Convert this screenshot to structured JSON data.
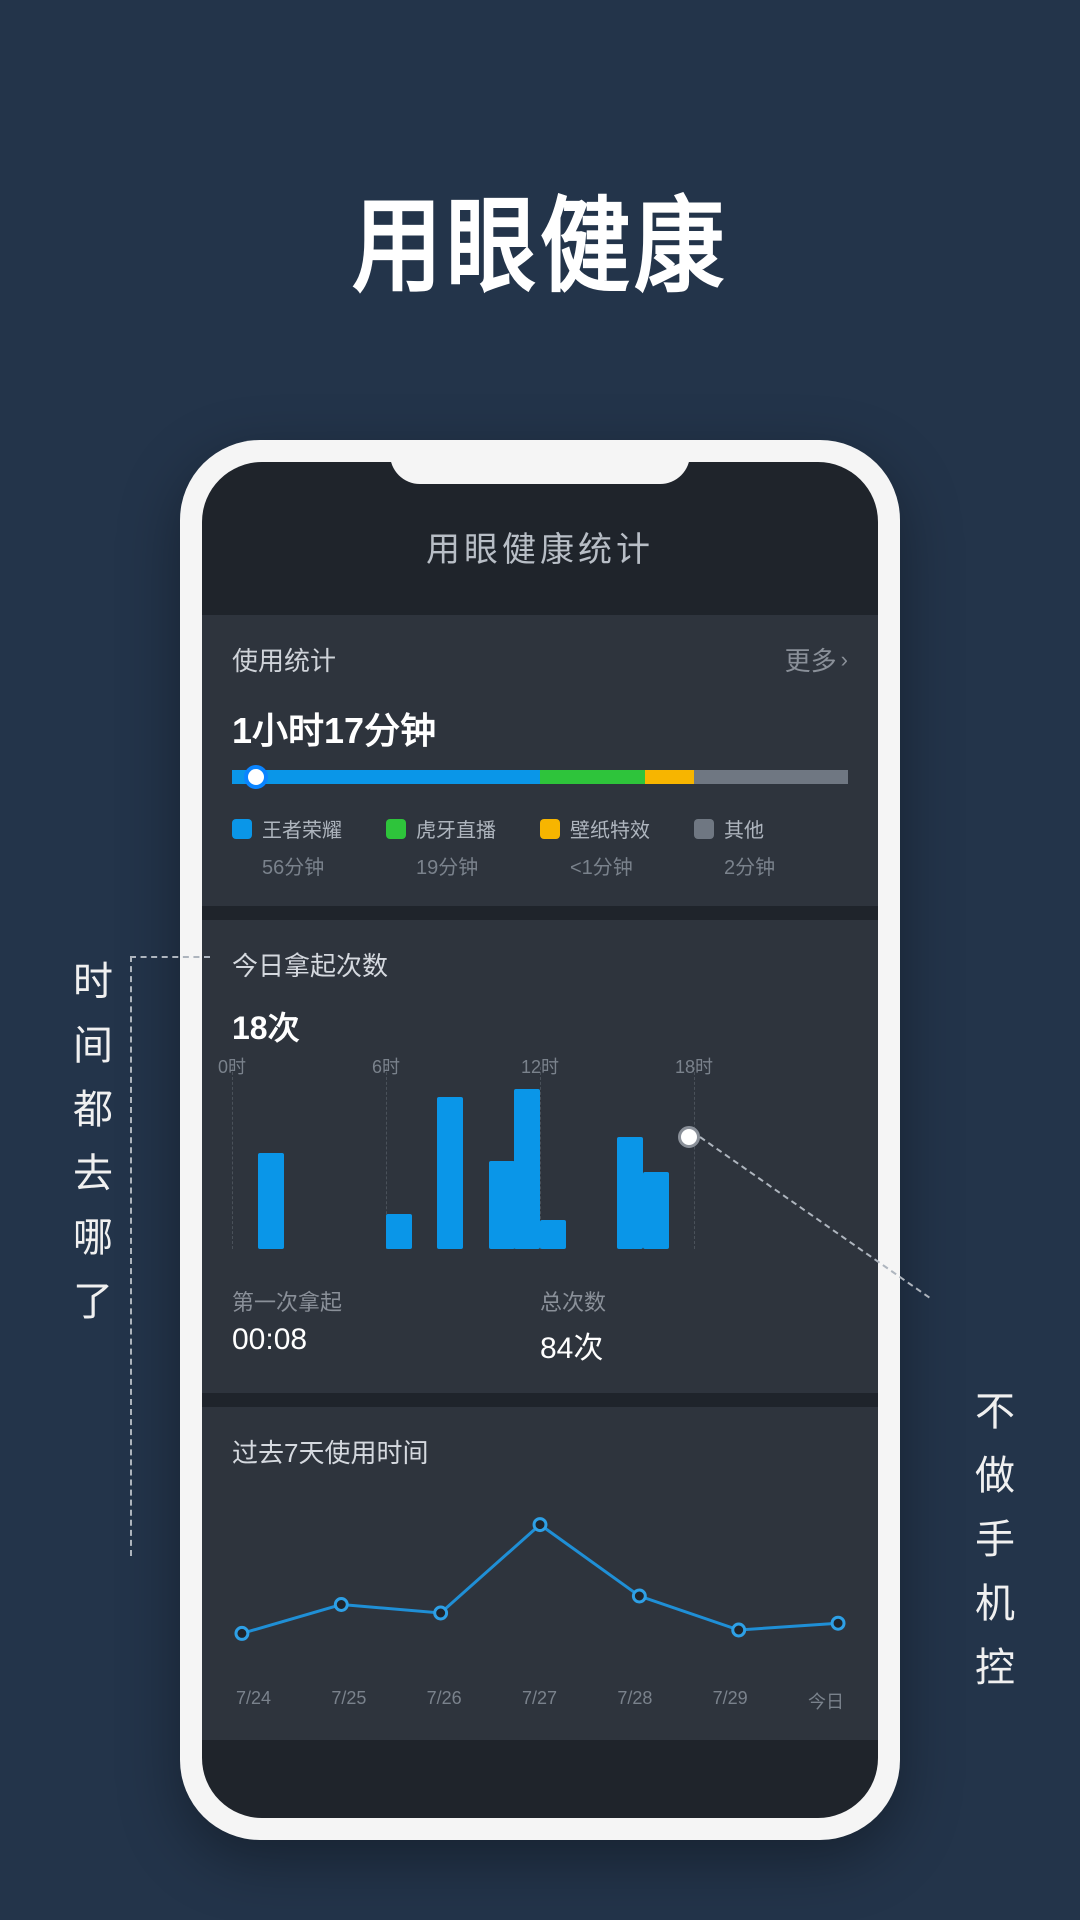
{
  "page_title": "用眼健康",
  "side_left": "时间都去哪了",
  "side_right": "不做手机控",
  "screen_title": "用眼健康统计",
  "usage": {
    "header": "使用统计",
    "more": "更多",
    "total": "1小时17分钟",
    "segments": [
      {
        "name": "王者荣耀",
        "time": "56分钟",
        "color": "#0a96e8",
        "pct": 50
      },
      {
        "name": "虎牙直播",
        "time": "19分钟",
        "color": "#2ec43b",
        "pct": 17
      },
      {
        "name": "壁纸特效",
        "time": "<1分钟",
        "color": "#f7b500",
        "pct": 8
      },
      {
        "name": "其他",
        "time": "2分钟",
        "color": "#6f7782",
        "pct": 25
      }
    ]
  },
  "pickups": {
    "title": "今日拿起次数",
    "count": "18次",
    "first_label": "第一次拿起",
    "first_value": "00:08",
    "total_label": "总次数",
    "total_value": "84次",
    "axis": [
      "0时",
      "6时",
      "12时",
      "18时"
    ]
  },
  "week": {
    "title": "过去7天使用时间",
    "labels": [
      "7/24",
      "7/25",
      "7/26",
      "7/27",
      "7/28",
      "7/29",
      "今日"
    ]
  },
  "chart_data": [
    {
      "type": "bar",
      "title": "今日拿起次数",
      "x_marks": [
        0,
        6,
        12,
        18
      ],
      "bars": [
        {
          "hour": 1,
          "value": 60
        },
        {
          "hour": 6,
          "value": 22
        },
        {
          "hour": 8,
          "value": 95
        },
        {
          "hour": 10,
          "value": 55
        },
        {
          "hour": 11,
          "value": 100
        },
        {
          "hour": 12,
          "value": 18
        },
        {
          "hour": 15,
          "value": 70
        },
        {
          "hour": 16,
          "value": 48
        }
      ],
      "ylim": [
        0,
        100
      ]
    },
    {
      "type": "line",
      "title": "过去7天使用时间",
      "categories": [
        "7/24",
        "7/25",
        "7/26",
        "7/27",
        "7/28",
        "7/29",
        "今日"
      ],
      "values": [
        18,
        35,
        30,
        82,
        40,
        20,
        24
      ],
      "ylim": [
        0,
        100
      ]
    }
  ]
}
